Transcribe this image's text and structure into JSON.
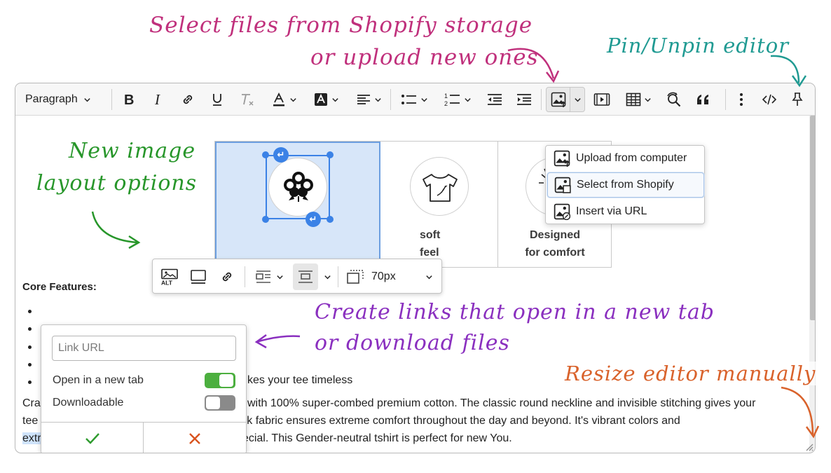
{
  "annotations": {
    "select_files_line1": "Select files from Shopify storage",
    "select_files_line2": "or upload new ones",
    "pin_unpin": "Pin/Unpin editor",
    "layout_line1": "New image",
    "layout_line2": "layout options",
    "links_line1": "Create links that open in a new tab",
    "links_line2": "or download files",
    "resize": "Resize editor manually"
  },
  "toolbar": {
    "paragraph_label": "Paragraph"
  },
  "image_dropdown": {
    "items": [
      {
        "label": "Upload from computer"
      },
      {
        "label": "Select from Shopify"
      },
      {
        "label": "Insert via URL"
      }
    ]
  },
  "image_toolbar": {
    "size_value": "70px"
  },
  "grid": {
    "cells": [
      {
        "caption_line1": "",
        "caption_line2": ""
      },
      {
        "caption_line1": "soft",
        "caption_line2": "feel"
      },
      {
        "caption_line1": "Designed",
        "caption_line2": "for comfort"
      }
    ]
  },
  "content": {
    "core_features_heading": "Core Features:",
    "bullet_tail": "kes your tee timeless",
    "para_line1_start": "Cra",
    "para_line1_end": "with 100% super-combed premium cotton. The classic round neckline and invisible stitching gives your",
    "para_line2_start": "tee a s",
    "para_line2_end": "rushed, pre-shrunk fabric ensures extreme comfort throughout the day and beyond. It's vibrant colors and",
    "para_line3_highlight": "extra soft fresh",
    "para_line3_rest": " feel makes your everyday special. This Gender-neutral tshirt is perfect for new You."
  },
  "link_popup": {
    "url_placeholder": "Link URL",
    "new_tab_label": "Open in a new tab",
    "new_tab_on": true,
    "download_label": "Downloadable",
    "download_on": false,
    "confirm_icon": "check-icon",
    "cancel_icon": "x-icon"
  },
  "colors": {
    "accent_blue": "#3b82e6",
    "toggle_on": "#4caf3f",
    "toggle_off": "#8a8a8a",
    "confirm": "#2e9b2e",
    "cancel": "#d9531e"
  }
}
